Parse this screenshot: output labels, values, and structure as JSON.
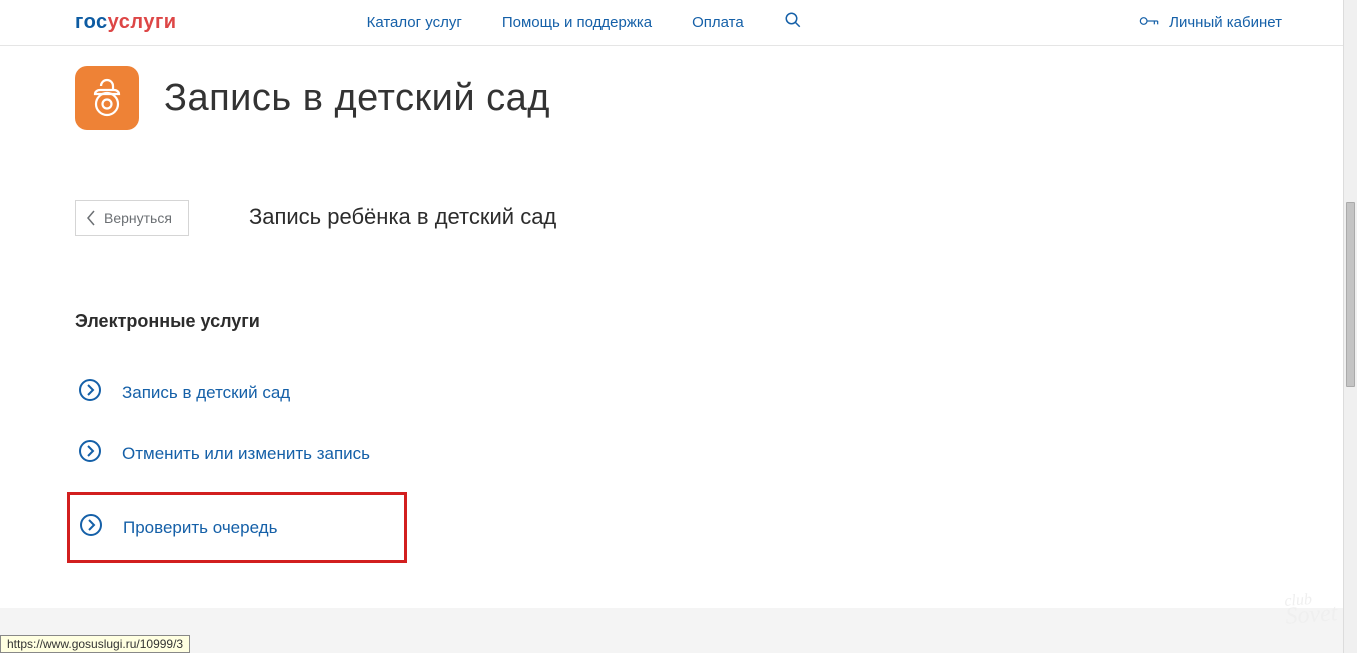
{
  "header": {
    "logo_gos": "гос",
    "logo_uslugi": "услуги",
    "nav": {
      "catalog": "Каталог услуг",
      "help": "Помощь и поддержка",
      "payment": "Оплата"
    },
    "cabinet": "Личный кабинет"
  },
  "main": {
    "title": "Запись в детский сад",
    "back_label": "Вернуться",
    "subtitle": "Запись ребёнка в детский сад",
    "section_heading": "Электронные услуги",
    "services": {
      "enroll": "Запись в детский сад",
      "cancel": "Отменить или изменить запись",
      "check_queue": "Проверить очередь"
    }
  },
  "status_url": "https://www.gosuslugi.ru/10999/3",
  "watermark_top": "club",
  "watermark": "Sovet"
}
